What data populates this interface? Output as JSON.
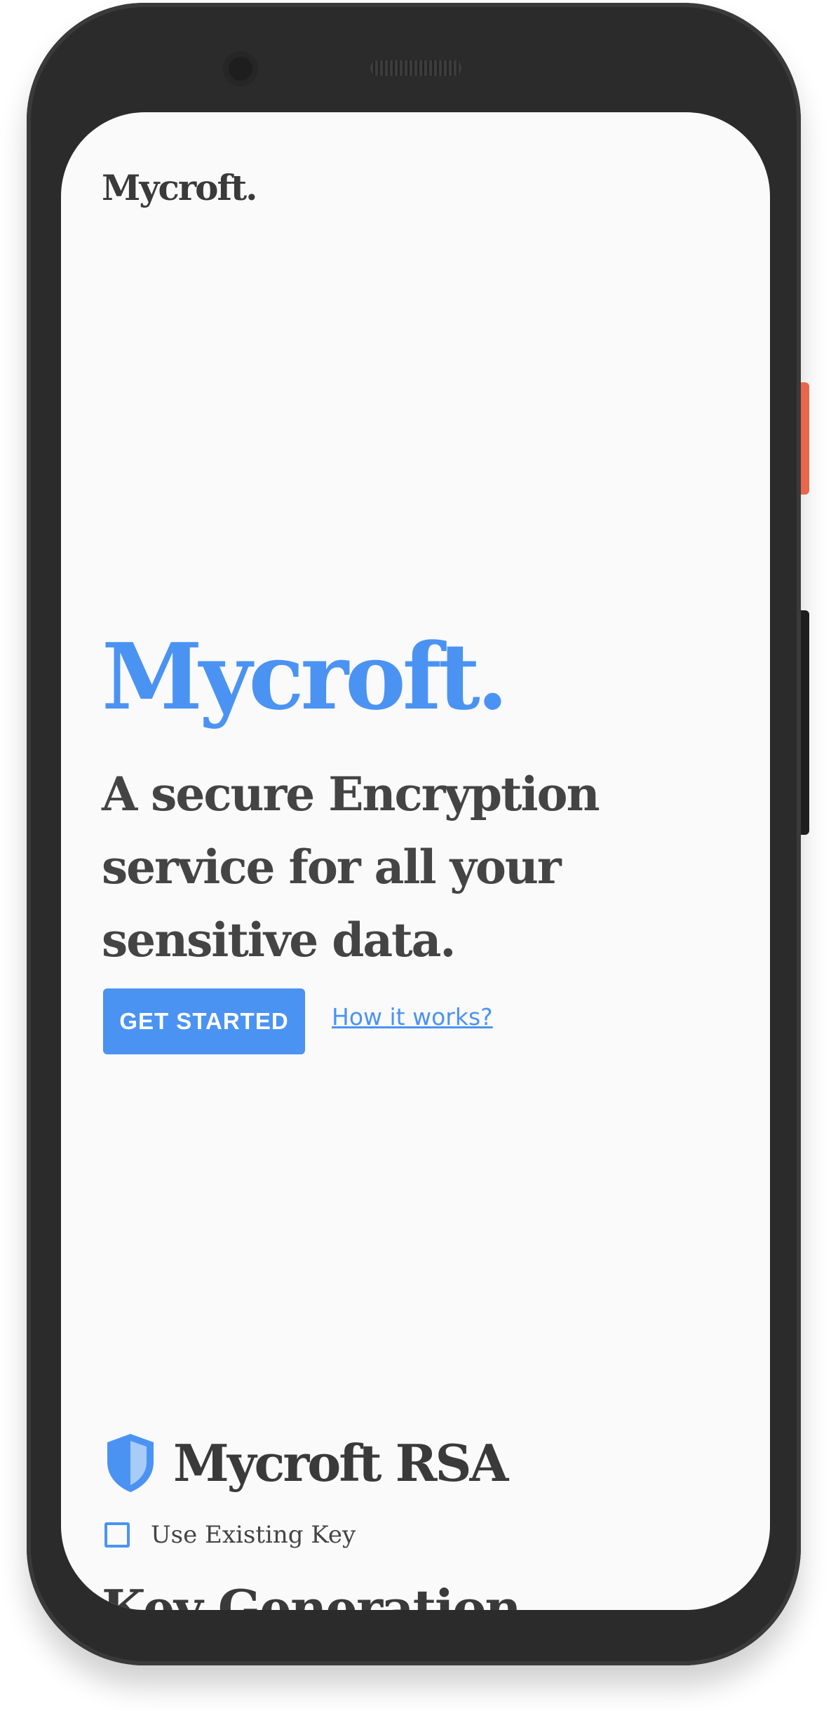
{
  "header": {
    "brand": "Mycroft."
  },
  "hero": {
    "title": "Mycroft.",
    "subtitle": "A secure Encryption service for all your sensitive data.",
    "cta_label": "GET STARTED",
    "link_label": "How it works?"
  },
  "rsa_section": {
    "icon": "shield-icon",
    "title": "Mycroft RSA",
    "checkbox_label": "Use Existing Key",
    "checkbox_checked": false,
    "next_heading": "Key Generation"
  },
  "colors": {
    "accent": "#4b93f2",
    "text": "#3a3a3a",
    "background": "#fafafa",
    "frame": "#2b2b2b",
    "side_button": "#e8674b"
  }
}
